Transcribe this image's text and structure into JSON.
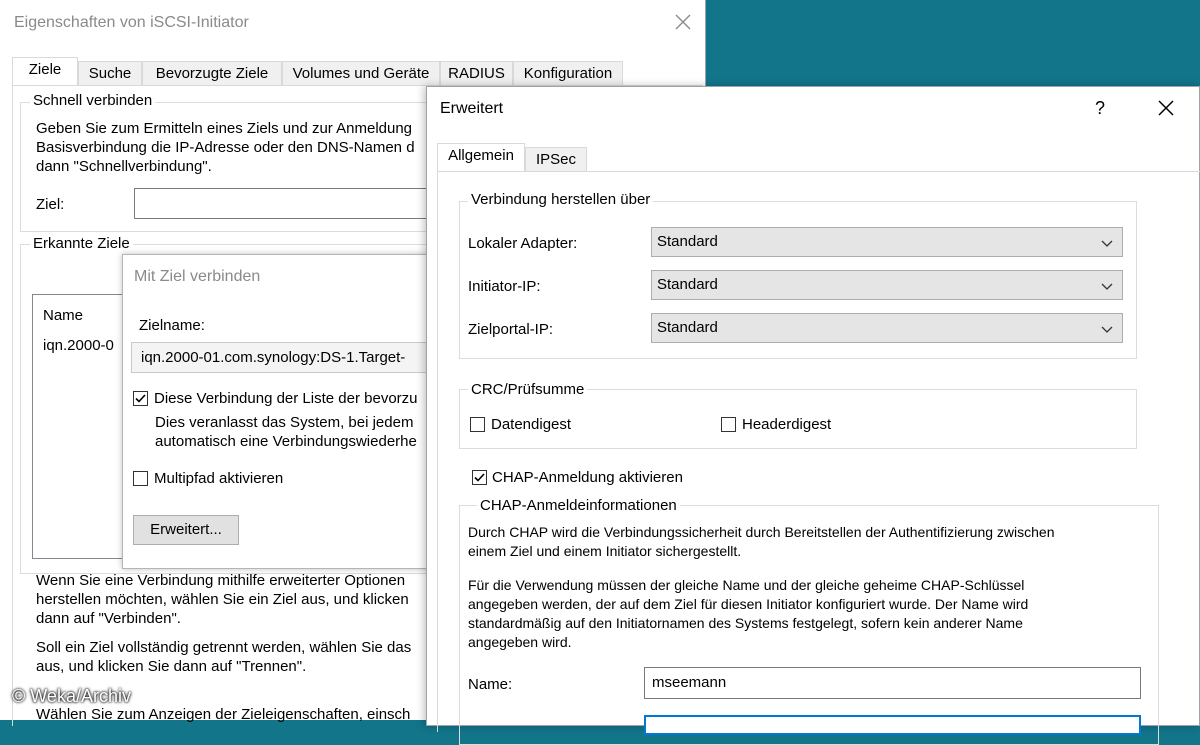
{
  "iscsi_window": {
    "title": "Eigenschaften von iSCSI-Initiator",
    "tabs": [
      "Ziele",
      "Suche",
      "Bevorzugte Ziele",
      "Volumes und Geräte",
      "RADIUS",
      "Konfiguration"
    ],
    "quick_connect": {
      "legend": "Schnell verbinden",
      "lines": [
        "Geben Sie zum Ermitteln eines Ziels und zur Anmeldung",
        "Basisverbindung die IP-Adresse oder den DNS-Namen d",
        "dann \"Schnellverbindung\"."
      ],
      "target_label": "Ziel:",
      "target_value": ""
    },
    "discovered": {
      "legend": "Erkannte Ziele",
      "column_name": "Name",
      "row_value": "iqn.2000-0"
    },
    "bottom_text": {
      "p1": [
        "Wenn Sie eine Verbindung mithilfe erweiterter Optionen",
        "herstellen möchten, wählen Sie ein Ziel aus, und klicken",
        "dann auf \"Verbinden\"."
      ],
      "p2": [
        "Soll ein Ziel vollständig getrennt werden, wählen Sie das",
        "aus, und klicken Sie dann auf \"Trennen\"."
      ],
      "p3": "Wählen Sie zum Anzeigen der Zieleigenschaften, einsch"
    }
  },
  "connect_window": {
    "title": "Mit Ziel verbinden",
    "target_name_label": "Zielname:",
    "target_name_value": "iqn.2000-01.com.synology:DS-1.Target-",
    "favorites_checkbox": "Diese Verbindung der Liste der bevorzu",
    "favorites_desc": [
      "Dies veranlasst das System, bei jedem",
      "automatisch eine Verbindungswiederhe"
    ],
    "multipath_checkbox": "Multipfad aktivieren",
    "advanced_button": "Erweitert..."
  },
  "advanced_window": {
    "title": "Erweitert",
    "help_glyph": "?",
    "tabs": [
      "Allgemein",
      "IPSec"
    ],
    "connect_group": {
      "legend": "Verbindung herstellen über",
      "local_adapter_label": "Lokaler Adapter:",
      "local_adapter_value": "Standard",
      "initiator_ip_label": "Initiator-IP:",
      "initiator_ip_value": "Standard",
      "target_portal_label": "Zielportal-IP:",
      "target_portal_value": "Standard"
    },
    "crc_group": {
      "legend": "CRC/Prüfsumme",
      "data_digest": "Datendigest",
      "header_digest": "Headerdigest"
    },
    "chap_enable": "CHAP-Anmeldung aktivieren",
    "chap_group": {
      "legend": "CHAP-Anmeldeinformationen",
      "desc1": [
        "Durch CHAP wird die Verbindungssicherheit durch Bereitstellen der Authentifizierung zwischen",
        "einem Ziel und einem Initiator sichergestellt."
      ],
      "desc2": [
        "Für die Verwendung müssen der gleiche Name und der gleiche geheime CHAP-Schlüssel",
        "angegeben werden, der auf dem Ziel für diesen Initiator konfiguriert wurde. Der Name wird",
        "standardmäßig auf den Initiatornamen des Systems festgelegt, sofern kein anderer Name",
        "angegeben wird."
      ],
      "name_label": "Name:",
      "name_value": "mseemann"
    }
  },
  "watermark": "© Weka/Archiv"
}
